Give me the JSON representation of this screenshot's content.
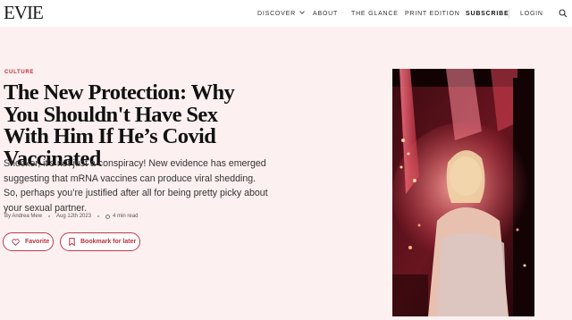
{
  "header": {
    "logo": "EVIE",
    "nav": {
      "discover": "DISCOVER",
      "about": "ABOUT",
      "glance": "THE GLANCE",
      "print": "PRINT EDITION",
      "subscribe": "SUBSCRIBE",
      "login": "LOGIN"
    },
    "search_icon": "search-icon"
  },
  "article": {
    "category": "CULTURE",
    "title": "The New Protection: Why You Shouldn't Have Sex With Him If He’s Covid Vaccinated",
    "dek": "Shocker, it’s not just a conspiracy! New evidence has emerged suggesting that mRNA vaccines can produce viral shedding. So, perhaps you’re justified after all for being pretty picky about your sexual partner.",
    "author": "By Andrea Mew",
    "date": "Aug 12th 2023",
    "read_time": "4 min read"
  },
  "actions": {
    "favorite": "Favorite",
    "bookmark": "Bookmark for later"
  },
  "colors": {
    "accent": "#b8323a",
    "background": "#fdf0f1"
  }
}
